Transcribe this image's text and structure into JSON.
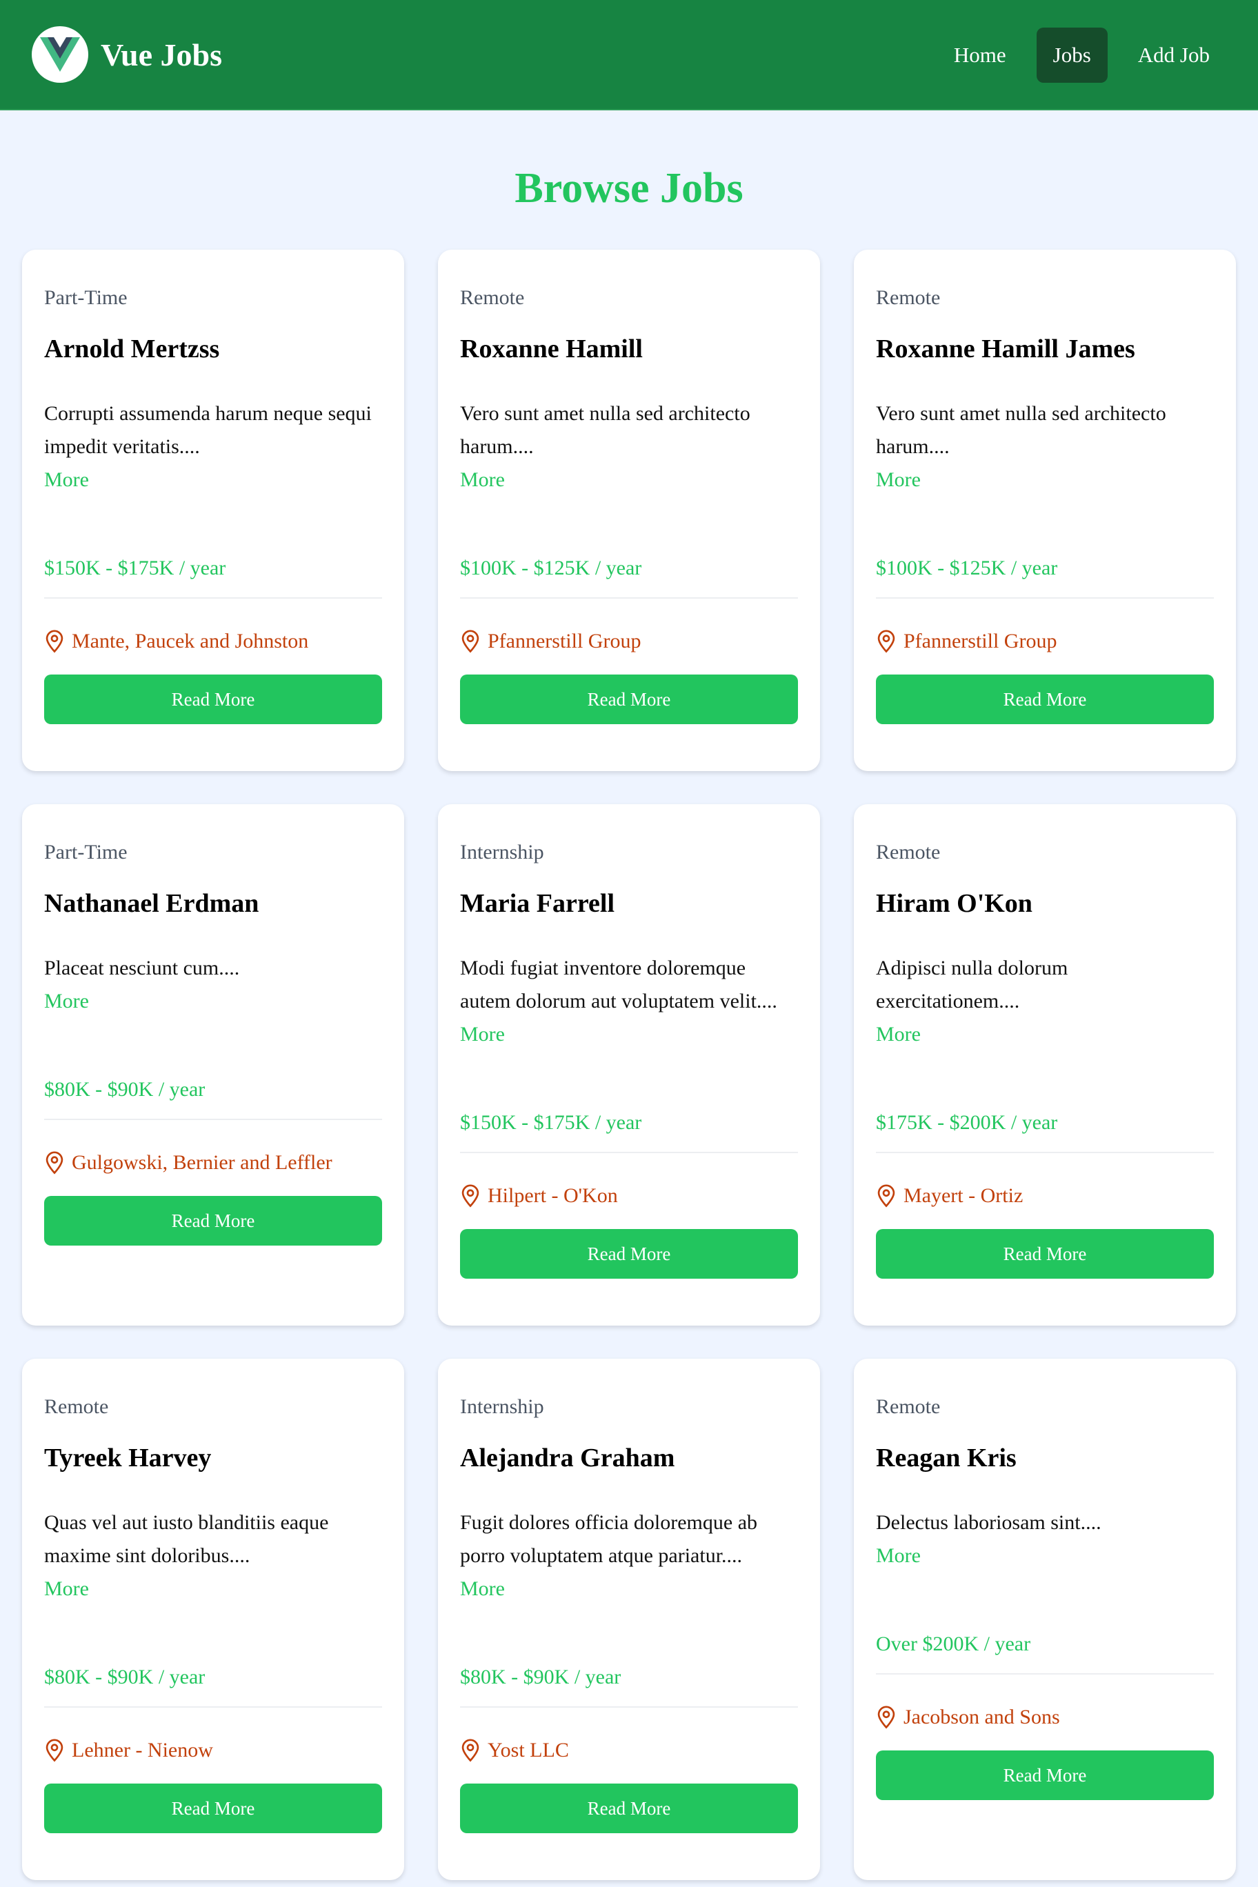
{
  "brand": {
    "title": "Vue Jobs"
  },
  "nav": {
    "links": [
      {
        "label": "Home",
        "active": false
      },
      {
        "label": "Jobs",
        "active": true
      },
      {
        "label": "Add Job",
        "active": false
      }
    ]
  },
  "page": {
    "title": "Browse Jobs"
  },
  "colors": {
    "navbar": "#178442",
    "accent": "#22c55e",
    "location": "#c2410c",
    "background": "#eef4ff"
  },
  "jobs": [
    {
      "type": "Part-Time",
      "title": "Arnold Mertzss",
      "description": "Corrupti assumenda harum neque sequi impedit veritatis....",
      "more": "More",
      "salary": "$150K - $175K / year",
      "location": "Mante, Paucek and Johnston",
      "button": "Read More"
    },
    {
      "type": "Remote",
      "title": "Roxanne Hamill",
      "description": "Vero sunt amet nulla sed architecto harum....",
      "more": "More",
      "salary": "$100K - $125K / year",
      "location": "Pfannerstill Group",
      "button": "Read More"
    },
    {
      "type": "Remote",
      "title": "Roxanne Hamill James",
      "description": "Vero sunt amet nulla sed architecto harum....",
      "more": "More",
      "salary": "$100K - $125K / year",
      "location": "Pfannerstill Group",
      "button": "Read More"
    },
    {
      "type": "Part-Time",
      "title": "Nathanael Erdman",
      "description": "Placeat nesciunt cum....",
      "more": "More",
      "salary": "$80K - $90K / year",
      "location": "Gulgowski, Bernier and Leffler",
      "button": "Read More"
    },
    {
      "type": "Internship",
      "title": "Maria Farrell",
      "description": "Modi fugiat inventore doloremque autem dolorum aut voluptatem velit....",
      "more": "More",
      "salary": "$150K - $175K / year",
      "location": "Hilpert - O'Kon",
      "button": "Read More"
    },
    {
      "type": "Remote",
      "title": "Hiram O'Kon",
      "description": "Adipisci nulla dolorum exercitationem....",
      "more": "More",
      "salary": "$175K - $200K / year",
      "location": "Mayert - Ortiz",
      "button": "Read More"
    },
    {
      "type": "Remote",
      "title": "Tyreek Harvey",
      "description": "Quas vel aut iusto blanditiis eaque maxime sint doloribus....",
      "more": "More",
      "salary": "$80K - $90K / year",
      "location": "Lehner - Nienow",
      "button": "Read More"
    },
    {
      "type": "Internship",
      "title": "Alejandra Graham",
      "description": "Fugit dolores officia doloremque ab porro voluptatem atque pariatur....",
      "more": "More",
      "salary": "$80K - $90K / year",
      "location": "Yost LLC",
      "button": "Read More"
    },
    {
      "type": "Remote",
      "title": "Reagan Kris",
      "description": "Delectus laboriosam sint....",
      "more": "More",
      "salary": "Over $200K / year",
      "location": "Jacobson and Sons",
      "button": "Read More"
    }
  ]
}
